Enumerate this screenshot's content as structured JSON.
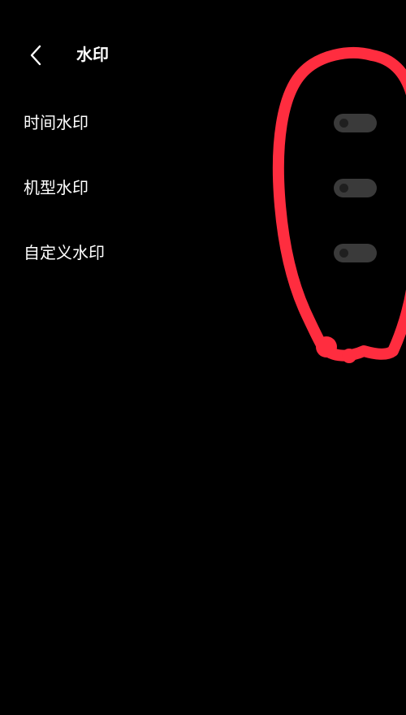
{
  "header": {
    "back_icon": "chevron-left-icon",
    "title": "水印"
  },
  "settings": [
    {
      "label": "时间水印",
      "enabled": false
    },
    {
      "label": "机型水印",
      "enabled": false
    },
    {
      "label": "自定义水印",
      "enabled": false
    }
  ],
  "colors": {
    "background": "#000000",
    "text": "#ffffff",
    "toggle_off_track": "#3a3a3a",
    "toggle_off_knob": "#1f1f1f",
    "annotation": "#ff2d3f"
  }
}
